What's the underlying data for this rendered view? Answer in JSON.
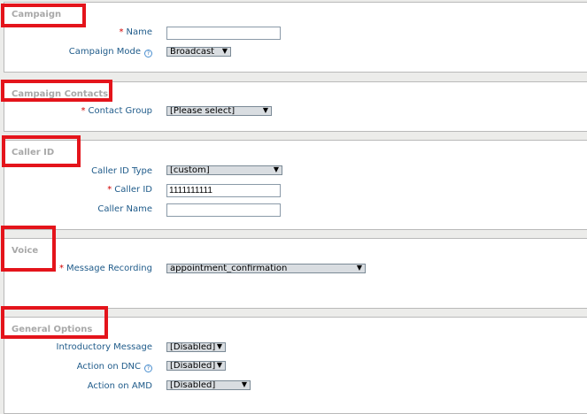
{
  "sections": {
    "campaign": {
      "title": "Campaign"
    },
    "contacts": {
      "title": "Campaign Contacts"
    },
    "caller_id": {
      "title": "Caller ID"
    },
    "voice": {
      "title": "Voice"
    },
    "general": {
      "title": "General Options"
    }
  },
  "fields": {
    "name": {
      "label": "Name",
      "value": ""
    },
    "campaign_mode": {
      "label": "Campaign Mode",
      "value": "Broadcast"
    },
    "contact_group": {
      "label": "Contact Group",
      "value": "[Please select]"
    },
    "caller_id_type": {
      "label": "Caller ID Type",
      "value": "[custom]"
    },
    "caller_id": {
      "label": "Caller ID",
      "value": "1111111111"
    },
    "caller_name": {
      "label": "Caller Name",
      "value": ""
    },
    "message_recording": {
      "label": "Message Recording",
      "value": "appointment_confirmation"
    },
    "intro_message": {
      "label": "Introductory Message",
      "value": "[Disabled]"
    },
    "action_dnc": {
      "label": "Action on DNC",
      "value": "[Disabled]"
    },
    "action_amd": {
      "label": "Action on AMD",
      "value": "[Disabled]"
    }
  },
  "icons": {
    "help": "help-icon",
    "dropdown": "dropdown-arrow-icon"
  },
  "symbols": {
    "required": "*",
    "help": "?",
    "arrow": "▼"
  },
  "colors": {
    "highlight": "#e4141b",
    "label": "#1f5b8a",
    "title": "#a8a8a8",
    "required": "#d00000"
  }
}
